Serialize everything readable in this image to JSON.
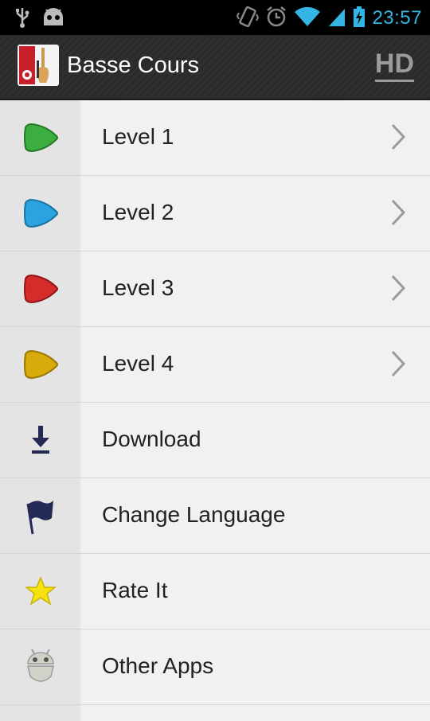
{
  "status_bar": {
    "time": "23:57",
    "icons": [
      "usb-icon",
      "android-debug-icon",
      "vibrate-icon",
      "alarm-icon",
      "wifi-icon",
      "signal-icon",
      "battery-charging-icon"
    ]
  },
  "action_bar": {
    "title": "Basse Cours",
    "hd_label": "HD"
  },
  "menu": {
    "items": [
      {
        "label": "Level 1",
        "icon": "green-pick-icon",
        "color": "#3cae3f",
        "chevron": true
      },
      {
        "label": "Level 2",
        "icon": "blue-pick-icon",
        "color": "#2aa3e0",
        "chevron": true
      },
      {
        "label": "Level 3",
        "icon": "red-pick-icon",
        "color": "#d52b2b",
        "chevron": true
      },
      {
        "label": "Level 4",
        "icon": "yellow-pick-icon",
        "color": "#d8ab0a",
        "chevron": true
      },
      {
        "label": "Download",
        "icon": "download-icon",
        "chevron": false
      },
      {
        "label": "Change Language",
        "icon": "flag-icon",
        "chevron": false
      },
      {
        "label": "Rate It",
        "icon": "star-icon",
        "chevron": false
      },
      {
        "label": "Other Apps",
        "icon": "android-icon",
        "chevron": false
      }
    ]
  }
}
